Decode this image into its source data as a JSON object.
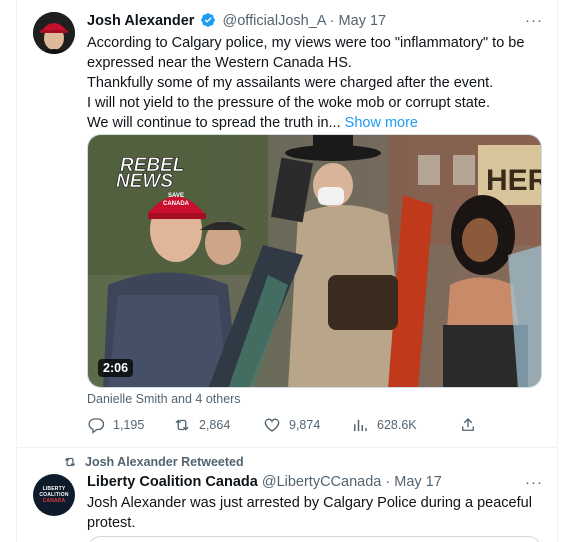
{
  "tweet1": {
    "author": "Josh Alexander",
    "handle": "@officialJosh_A",
    "separator": "·",
    "date": "May 17",
    "lines": [
      "According to Calgary police, my views were too \"inflammatory\" to be",
      "expressed near the Western Canada HS.",
      "Thankfully some of my assailants were charged after the event.",
      "I will not yield to the pressure of the woke mob or corrupt state.",
      "We will continue to spread the truth in..."
    ],
    "show_more": "Show more",
    "video": {
      "watermark_line1": "REBEL",
      "watermark_line2": "NEWS",
      "hat_text_1": "SAVE",
      "hat_text_2": "CANADA",
      "sign_text": "HER",
      "duration": "2:06"
    },
    "tagged": "Danielle Smith and 4 others",
    "stats": {
      "replies": "1,195",
      "retweets": "2,864",
      "likes": "9,874",
      "views": "628.6K"
    }
  },
  "retweet_note": "Josh Alexander Retweeted",
  "tweet2": {
    "author": "Liberty Coalition Canada",
    "handle": "@LibertyCCanada",
    "separator": "·",
    "date": "May 17",
    "avatar_line1": "LIBERTY",
    "avatar_line2": "COALITION",
    "avatar_line3": "CANADA",
    "lines": [
      "Josh Alexander was just arrested by Calgary Police during a peaceful",
      "protest."
    ]
  },
  "colors": {
    "accent": "#1d9bf0",
    "muted": "#536471",
    "text": "#0f1419",
    "hat_red": "#c8102e"
  },
  "icons": [
    "verified-badge-icon",
    "more-icon",
    "reply-icon",
    "retweet-icon",
    "like-icon",
    "views-icon",
    "share-icon"
  ]
}
